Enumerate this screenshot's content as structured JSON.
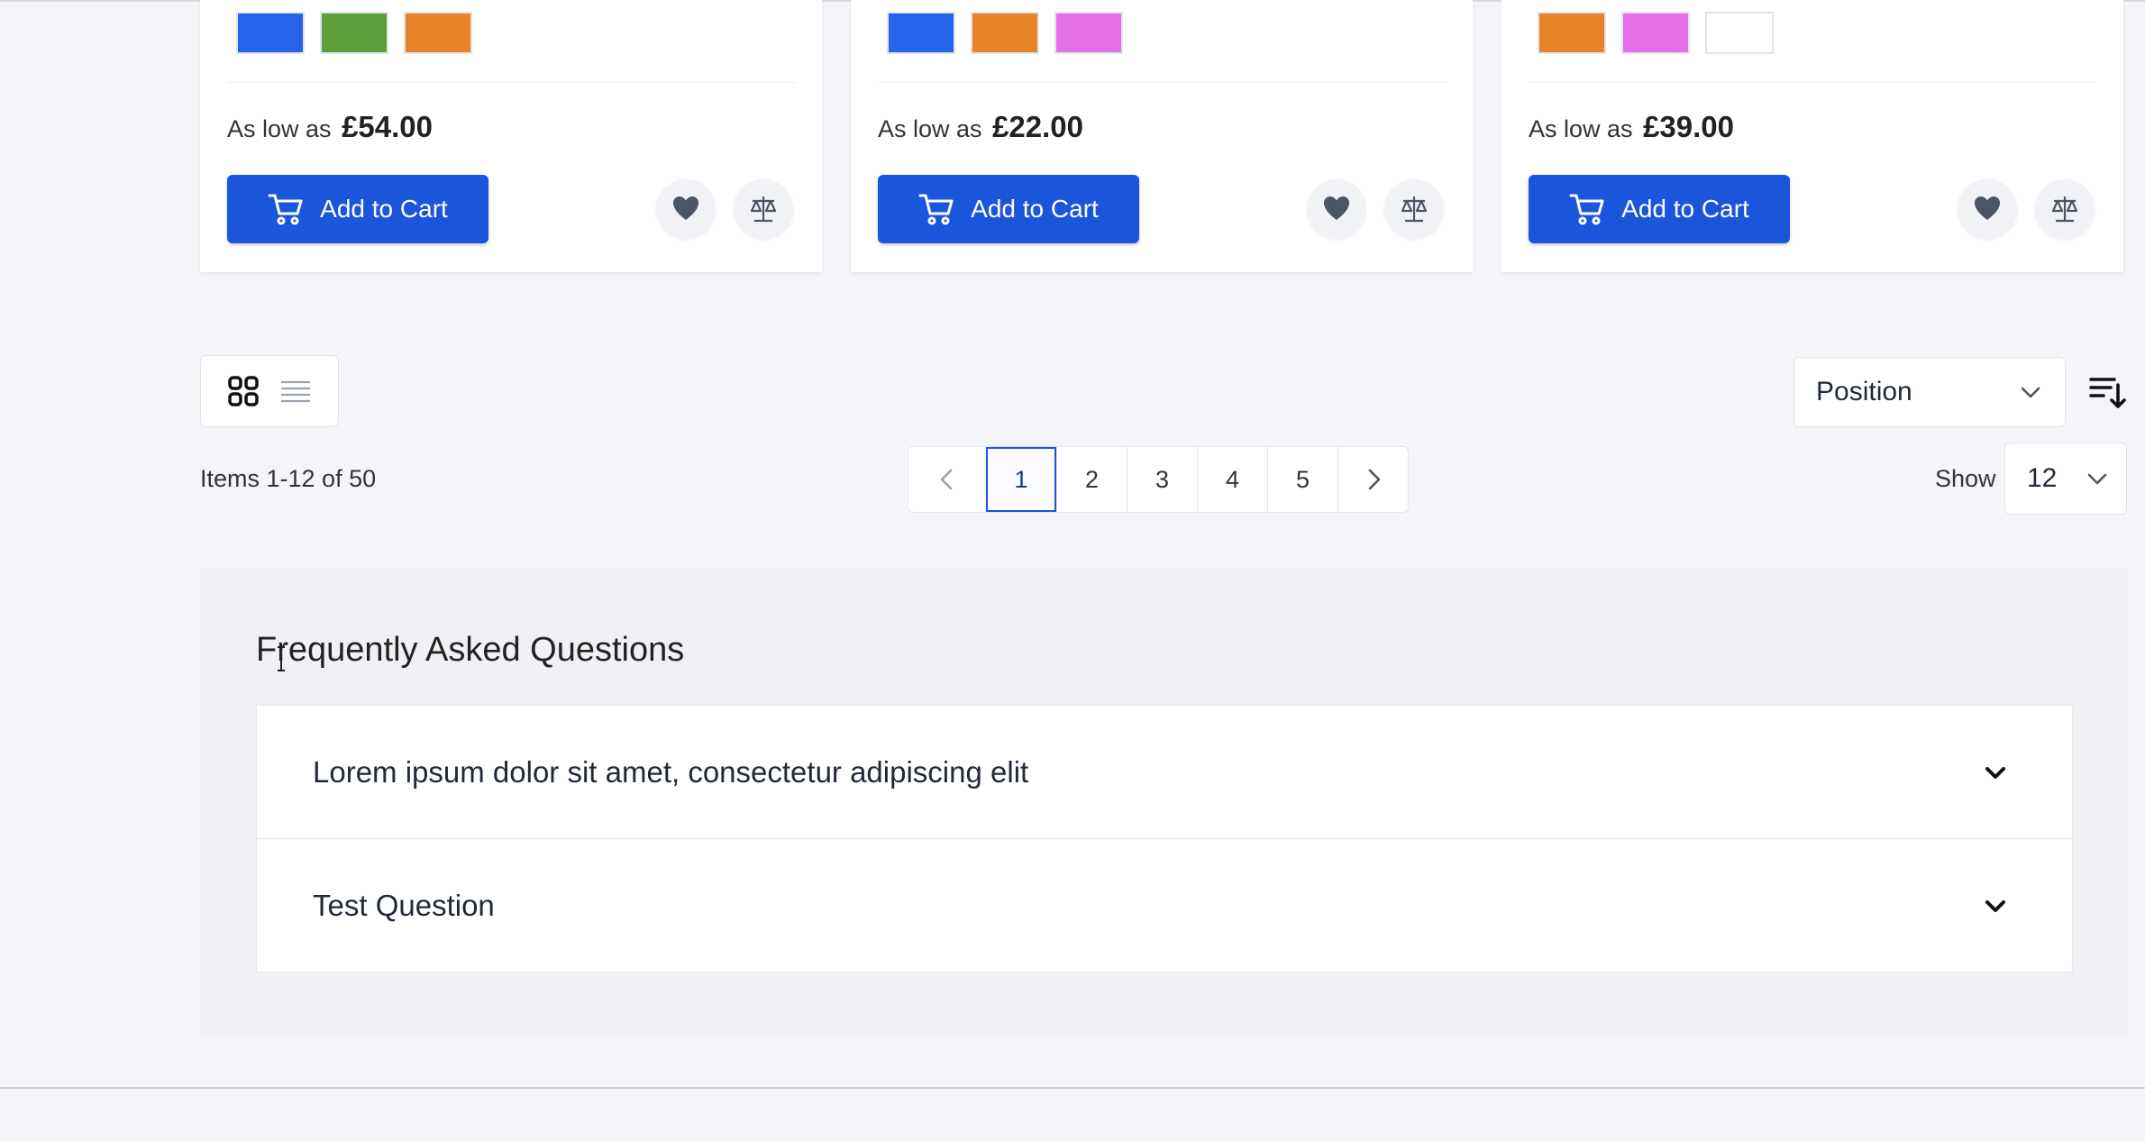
{
  "products": [
    {
      "swatches": [
        "#2563eb",
        "#5d9e3c",
        "#e8832a"
      ],
      "price_prefix": "As low as",
      "price": "£54.00",
      "add_to_cart_label": "Add to Cart"
    },
    {
      "swatches": [
        "#2563eb",
        "#e8832a",
        "#e46ee8"
      ],
      "price_prefix": "As low as",
      "price": "£22.00",
      "add_to_cart_label": "Add to Cart"
    },
    {
      "swatches": [
        "#e8832a",
        "#e46ee8",
        "#ffffff"
      ],
      "price_prefix": "As low as",
      "price": "£39.00",
      "add_to_cart_label": "Add to Cart"
    }
  ],
  "toolbar": {
    "view_modes": [
      "grid-icon",
      "list-icon"
    ],
    "sort_by": "Position",
    "items_count": "Items 1-12 of 50",
    "pages": [
      "1",
      "2",
      "3",
      "4",
      "5"
    ],
    "current_page": "1",
    "show_label": "Show",
    "limit": "12"
  },
  "faq": {
    "title": "Frequently Asked Questions",
    "items": [
      {
        "question": "Lorem ipsum dolor sit amet, consectetur adipiscing elit"
      },
      {
        "question": "Test Question"
      }
    ]
  },
  "colors": {
    "accent": "#1a56db",
    "page_bg": "#f4f5f8"
  }
}
